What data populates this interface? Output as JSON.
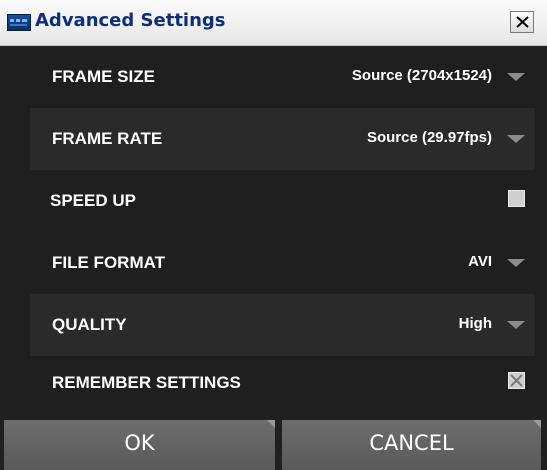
{
  "window": {
    "title": "Advanced Settings"
  },
  "settings": [
    {
      "label": "FRAME SIZE",
      "value": "Source (2704x1524)",
      "control": "dropdown"
    },
    {
      "label": "FRAME RATE",
      "value": "Source (29.97fps)",
      "control": "dropdown"
    },
    {
      "label": "SPEED UP",
      "control": "checkbox",
      "checked": false
    },
    {
      "label": "FILE FORMAT",
      "value": "AVI",
      "control": "dropdown"
    },
    {
      "label": "QUALITY",
      "value": "High",
      "control": "dropdown"
    },
    {
      "label": "REMEMBER SETTINGS",
      "control": "checkbox",
      "checked": true
    }
  ],
  "buttons": {
    "ok_label": "OK",
    "cancel_label": "CANCEL"
  },
  "colors": {
    "background": "#1f1f1f",
    "row_alt": "#2a2a2a",
    "title_text": "#0f2f78",
    "button": "#666666",
    "arrow": "#8c8c8c"
  },
  "icons": {
    "app": "app-window-icon",
    "close": "close-icon",
    "dropdown": "chevron-down-icon",
    "check": "check-x-icon"
  }
}
